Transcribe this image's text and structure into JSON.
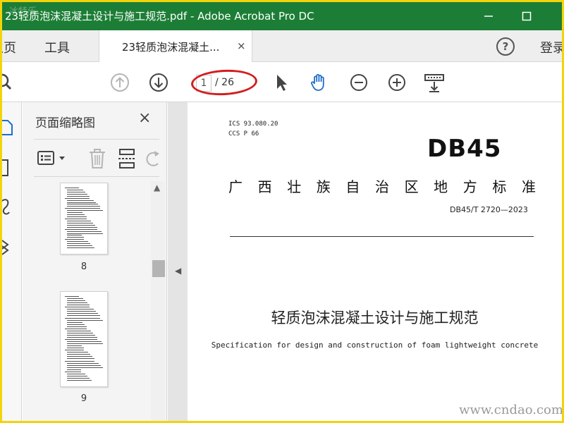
{
  "window": {
    "title": "23轻质泡沫混凝土设计与施工规范.pdf - Adobe Acrobat Pro DC",
    "watermark_corner": "冰特乐",
    "title_bar_color": "#1c7e36"
  },
  "tabs": {
    "home": "主页",
    "tools": "工具",
    "document": "23轻质泡沫混凝土...",
    "close_glyph": "×",
    "signin": "登录",
    "help_glyph": "?"
  },
  "toolbar": {
    "current_page": "1",
    "total_pages": "/ 26",
    "annotation_color": "#d21e1e",
    "icons": [
      "search-icon",
      "prev-page-icon",
      "next-page-icon",
      "select-cursor-icon",
      "hand-tool-icon",
      "zoom-out-icon",
      "zoom-in-icon",
      "page-fit-icon"
    ]
  },
  "thumbnails_panel": {
    "title": "页面缩略图",
    "close_glyph": "×",
    "pages": [
      {
        "label": "8"
      },
      {
        "label": "9"
      }
    ]
  },
  "document": {
    "ics": "ICS  93.080.20",
    "ccs": "CCS  P 66",
    "code": "DB45",
    "region_chars": [
      "广",
      "西",
      "壮",
      "族",
      "自",
      "治",
      "区",
      "地",
      "方",
      "标",
      "准"
    ],
    "standard_number": "DB45/T 2720—2023",
    "title_cn": "轻质泡沫混凝土设计与施工规范",
    "title_en": "Specification for design and construction of foam lightweight concrete",
    "site_watermark": "www.cndao.com"
  }
}
